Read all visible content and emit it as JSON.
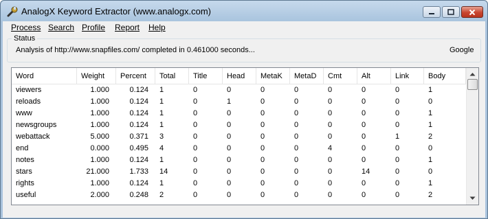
{
  "window": {
    "title": "AnalogX Keyword Extractor (www.analogx.com)",
    "icon": "wrench-icon"
  },
  "menu": [
    "Process",
    "Search",
    "Profile",
    "Report",
    "Help"
  ],
  "status": {
    "legend": "Status",
    "text": "Analysis of http://www.snapfiles.com/ completed in 0.461000 seconds...",
    "engine": "Google"
  },
  "table": {
    "columns": [
      "Word",
      "Weight",
      "Percent",
      "Total",
      "Title",
      "Head",
      "MetaK",
      "MetaD",
      "Cmt",
      "Alt",
      "Link",
      "Body"
    ],
    "rows": [
      [
        "viewers",
        "1.000",
        "0.124",
        "1",
        "0",
        "0",
        "0",
        "0",
        "0",
        "0",
        "0",
        "1"
      ],
      [
        "reloads",
        "1.000",
        "0.124",
        "1",
        "0",
        "1",
        "0",
        "0",
        "0",
        "0",
        "0",
        "0"
      ],
      [
        "www",
        "1.000",
        "0.124",
        "1",
        "0",
        "0",
        "0",
        "0",
        "0",
        "0",
        "0",
        "1"
      ],
      [
        "newsgroups",
        "1.000",
        "0.124",
        "1",
        "0",
        "0",
        "0",
        "0",
        "0",
        "0",
        "0",
        "1"
      ],
      [
        "webattack",
        "5.000",
        "0.371",
        "3",
        "0",
        "0",
        "0",
        "0",
        "0",
        "0",
        "1",
        "2"
      ],
      [
        "end",
        "0.000",
        "0.495",
        "4",
        "0",
        "0",
        "0",
        "0",
        "4",
        "0",
        "0",
        "0"
      ],
      [
        "notes",
        "1.000",
        "0.124",
        "1",
        "0",
        "0",
        "0",
        "0",
        "0",
        "0",
        "0",
        "1"
      ],
      [
        "stars",
        "21.000",
        "1.733",
        "14",
        "0",
        "0",
        "0",
        "0",
        "0",
        "14",
        "0",
        "0"
      ],
      [
        "rights",
        "1.000",
        "0.124",
        "1",
        "0",
        "0",
        "0",
        "0",
        "0",
        "0",
        "0",
        "1"
      ],
      [
        "useful",
        "2.000",
        "0.248",
        "2",
        "0",
        "0",
        "0",
        "0",
        "0",
        "0",
        "0",
        "2"
      ]
    ]
  },
  "colors": {
    "title_bar": "#a9c4de",
    "close_button": "#c8452f",
    "client_background": "#f0f0f0"
  }
}
